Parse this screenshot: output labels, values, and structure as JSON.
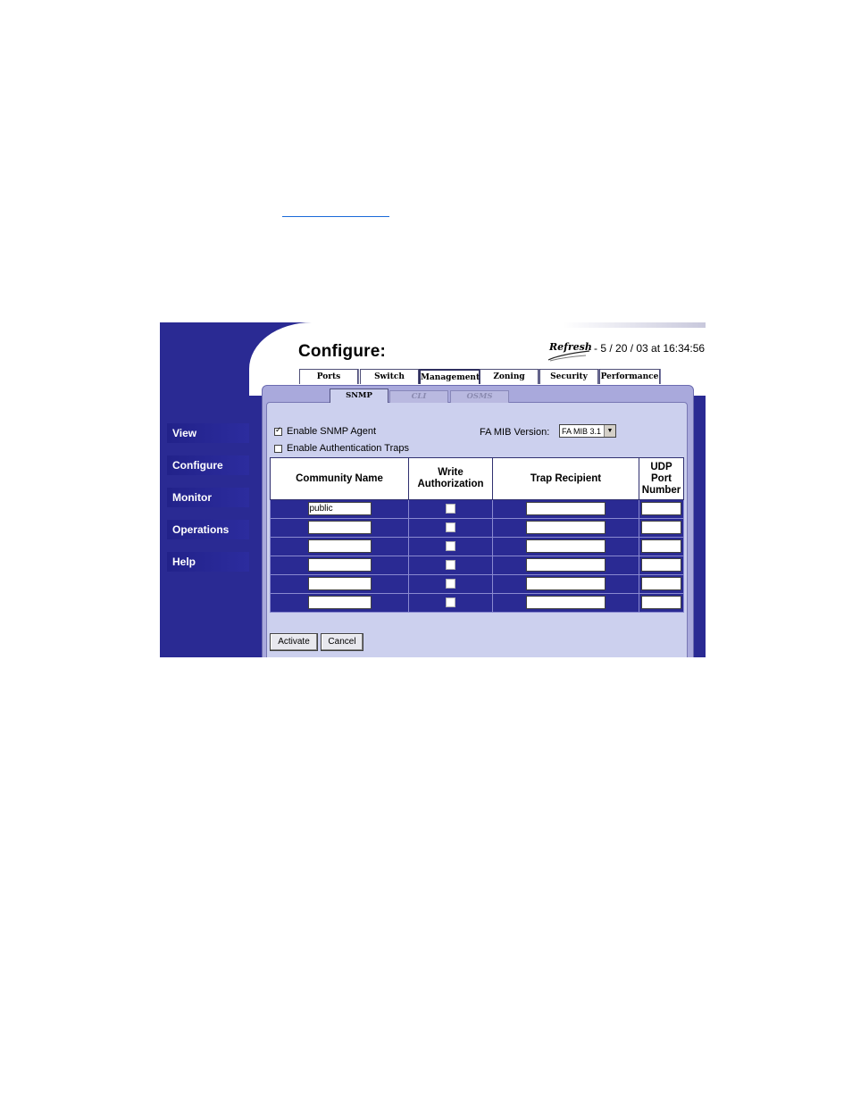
{
  "header": {
    "title": "Configure:",
    "refresh_label": "Refresh",
    "timestamp": "5 / 20 / 03 at 16:34:56"
  },
  "sidebar": {
    "items": [
      {
        "label": "View"
      },
      {
        "label": "Configure"
      },
      {
        "label": "Monitor"
      },
      {
        "label": "Operations"
      },
      {
        "label": "Help"
      }
    ]
  },
  "tabs": [
    {
      "label": "Ports"
    },
    {
      "label": "Switch"
    },
    {
      "label": "Management"
    },
    {
      "label": "Zoning"
    },
    {
      "label": "Security"
    },
    {
      "label": "Performance"
    }
  ],
  "active_tab": "Management",
  "subtabs": [
    {
      "label": "SNMP"
    },
    {
      "label": "CLI"
    },
    {
      "label": "OSMS"
    }
  ],
  "active_subtab": "SNMP",
  "options": {
    "enable_snmp_agent": {
      "label": "Enable SNMP Agent",
      "checked": true
    },
    "enable_auth_traps": {
      "label": "Enable Authentication Traps",
      "checked": false
    },
    "fa_mib_label": "FA MIB Version:",
    "fa_mib_value": "FA MIB 3.1"
  },
  "table": {
    "headers": {
      "community_name": "Community Name",
      "write_line1": "Write",
      "write_line2": "Authorization",
      "trap_recipient": "Trap Recipient",
      "udp_line1": "UDP",
      "udp_line2": "Port",
      "udp_line3": "Number"
    },
    "rows": [
      {
        "community": "public",
        "write": false,
        "trap": "",
        "port": ""
      },
      {
        "community": "",
        "write": false,
        "trap": "",
        "port": ""
      },
      {
        "community": "",
        "write": false,
        "trap": "",
        "port": ""
      },
      {
        "community": "",
        "write": false,
        "trap": "",
        "port": ""
      },
      {
        "community": "",
        "write": false,
        "trap": "",
        "port": ""
      },
      {
        "community": "",
        "write": false,
        "trap": "",
        "port": ""
      }
    ]
  },
  "buttons": {
    "activate": "Activate",
    "cancel": "Cancel"
  },
  "colors": {
    "sidebar_bg": "#2a2a93",
    "panel_bg": "#ccd0ee",
    "link": "#1a6ad8"
  }
}
